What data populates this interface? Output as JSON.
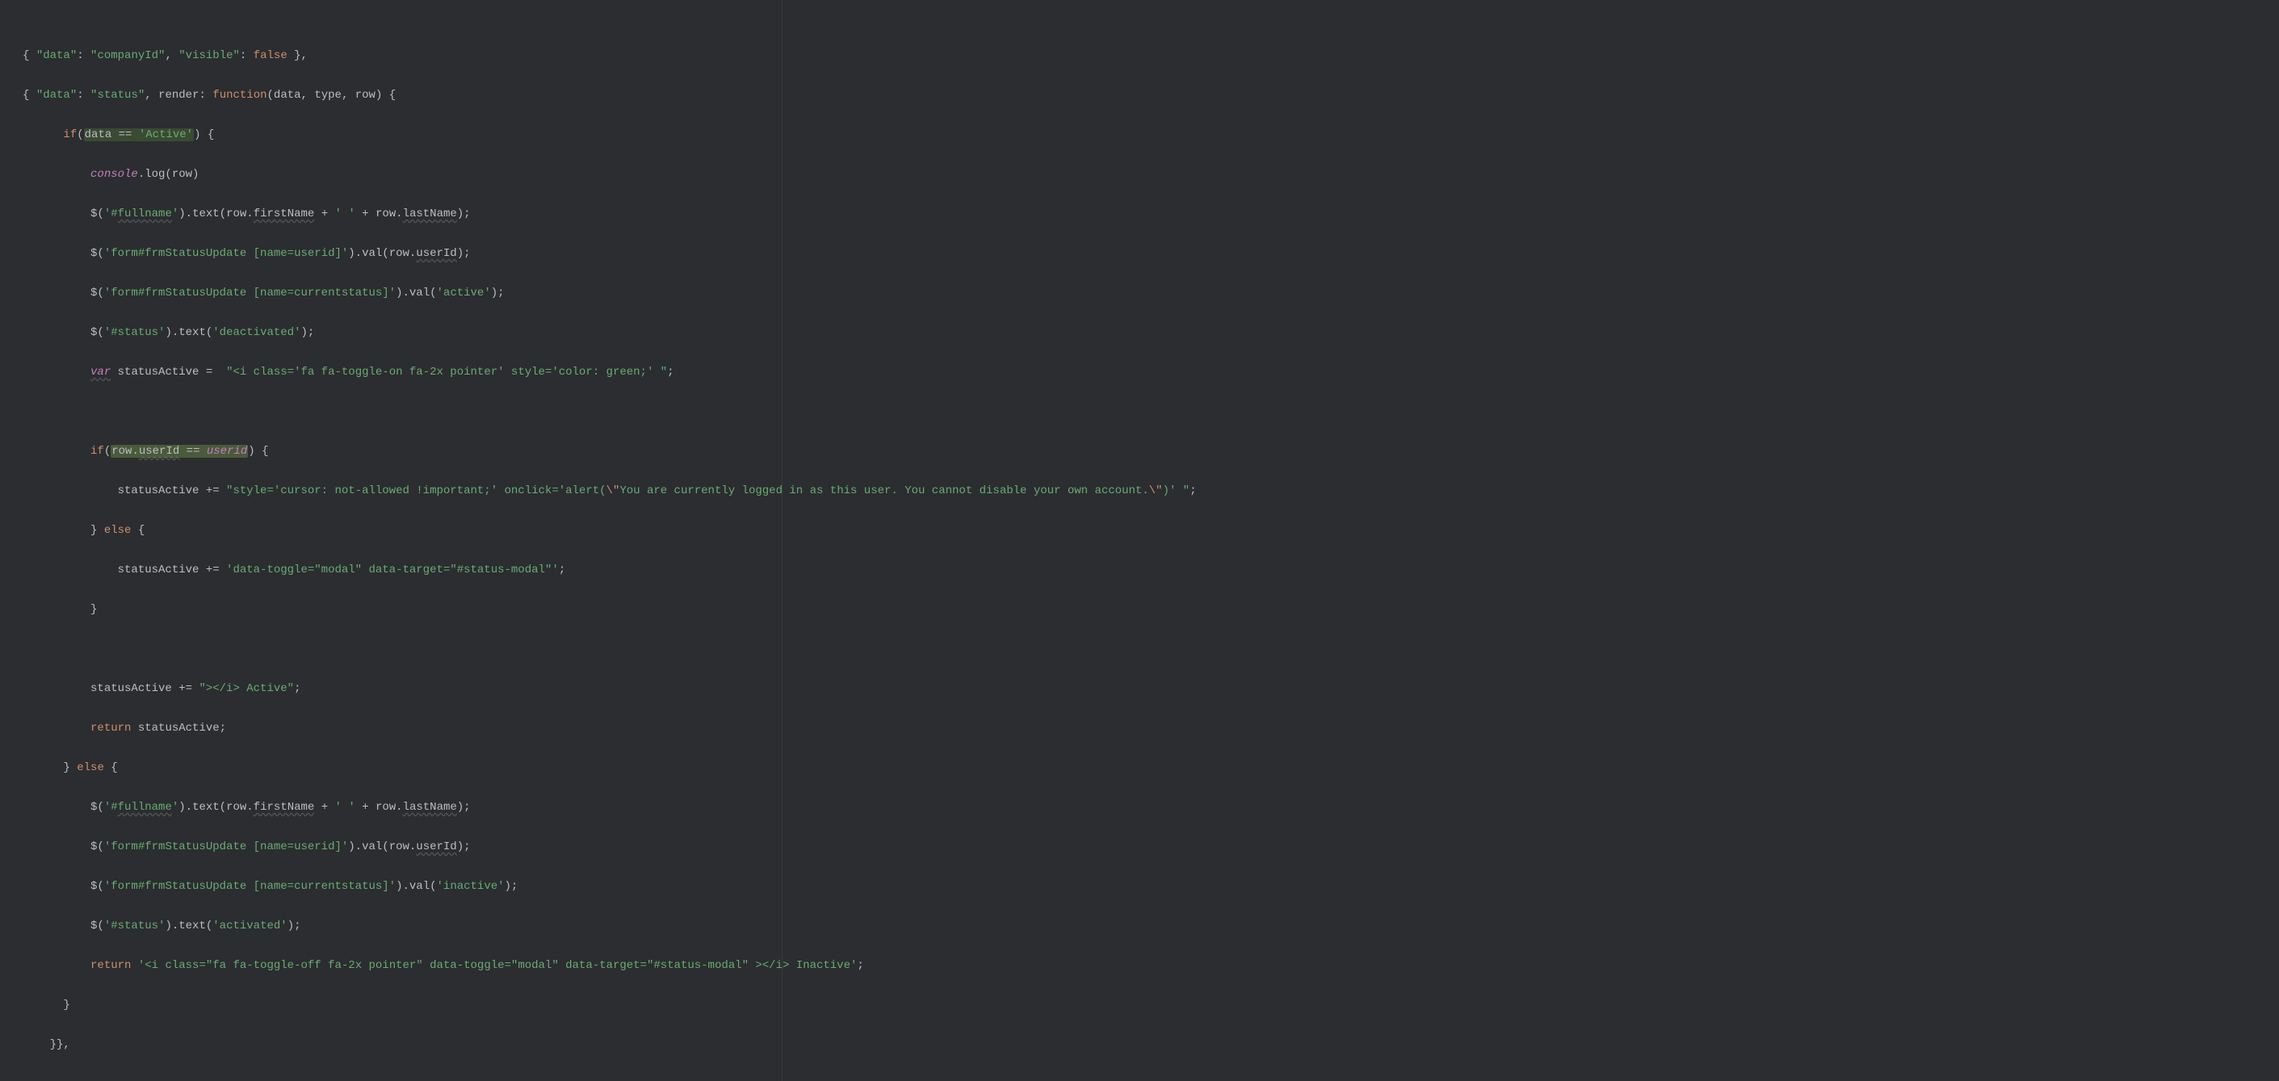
{
  "code": {
    "l0": {
      "a": "{ ",
      "b": "\"data\"",
      "c": ": ",
      "d": "\"companyId\"",
      "e": ", ",
      "f": "\"visible\"",
      "g": ": ",
      "h": "false",
      "i": " },"
    },
    "l1": {
      "a": "{ ",
      "b": "\"data\"",
      "c": ": ",
      "d": "\"status\"",
      "e": ", ",
      "f": "render",
      "g": ": ",
      "h": "function",
      "i": "(data, type, row) {"
    },
    "l2": {
      "a": "if",
      "b": "(",
      "c": "data == ",
      "d": "'Active'",
      "e": ") {"
    },
    "l3": {
      "a": "console",
      "b": ".log(row)"
    },
    "l4": {
      "a": "$(",
      "b": "'#",
      "c": "fullname",
      "d": "'",
      "e": ").text(row.",
      "f": "firstName",
      "g": " + ",
      "h": "' '",
      "i": " + row.",
      "j": "lastName",
      "k": ");"
    },
    "l5": {
      "a": "$(",
      "b": "'form#frmStatusUpdate [name=userid]'",
      "c": ").val(row.",
      "d": "userId",
      "e": ");"
    },
    "l6": {
      "a": "$(",
      "b": "'form#frmStatusUpdate [name=currentstatus]'",
      "c": ").val(",
      "d": "'active'",
      "e": ");"
    },
    "l7": {
      "a": "$(",
      "b": "'#status'",
      "c": ").text(",
      "d": "'deactivated'",
      "e": ");"
    },
    "l8": {
      "a": "var",
      "b": " statusActive =  ",
      "c": "\"<i class='fa fa-toggle-on fa-2x pointer' style='color: green;' \"",
      "d": ";"
    },
    "l9": "",
    "l10": {
      "a": "if",
      "b": "(",
      "c": "row.",
      "d": "userId",
      "e": " == ",
      "f": "userid",
      "g": ") {"
    },
    "l11": {
      "a": "statusActive += ",
      "b": "\"style='cursor: not-allowed !important;' onclick='alert(",
      "c": "\\\"",
      "d": "You are currently logged in as this user. You cannot disable your own account.",
      "e": "\\\"",
      "f": ")' \"",
      "g": ";"
    },
    "l12": {
      "a": "} ",
      "b": "else",
      "c": " {"
    },
    "l13": {
      "a": "statusActive += ",
      "b": "'data-toggle=\"modal\" data-target=\"#status-modal\"'",
      "c": ";"
    },
    "l14": {
      "a": "}"
    },
    "l15": "",
    "l16": {
      "a": "statusActive += ",
      "b": "\"></i> Active\"",
      "c": ";"
    },
    "l17": {
      "a": "return",
      "b": " statusActive;"
    },
    "l18": {
      "a": "} ",
      "b": "else",
      "c": " {"
    },
    "l19": {
      "a": "$(",
      "b": "'#",
      "c": "fullname",
      "d": "'",
      "e": ").text(row.",
      "f": "firstName",
      "g": " + ",
      "h": "' '",
      "i": " + row.",
      "j": "lastName",
      "k": ");"
    },
    "l20": {
      "a": "$(",
      "b": "'form#frmStatusUpdate [name=userid]'",
      "c": ").val(row.",
      "d": "userId",
      "e": ");"
    },
    "l21": {
      "a": "$(",
      "b": "'form#frmStatusUpdate [name=currentstatus]'",
      "c": ").val(",
      "d": "'inactive'",
      "e": ");"
    },
    "l22": {
      "a": "$(",
      "b": "'#status'",
      "c": ").text(",
      "d": "'activated'",
      "e": ");"
    },
    "l23": {
      "a": "return",
      "b": " ",
      "c": "'<i class=\"fa fa-toggle-off fa-2x pointer\" data-toggle=\"modal\" data-target=\"#status-modal\" ></i> Inactive'",
      "d": ";"
    },
    "l24": {
      "a": "}"
    },
    "l25": {
      "a": "}},"
    }
  },
  "indent": {
    "i0": "",
    "i1": "      ",
    "i2": "          ",
    "i3": "              ",
    "i4": "                  "
  }
}
